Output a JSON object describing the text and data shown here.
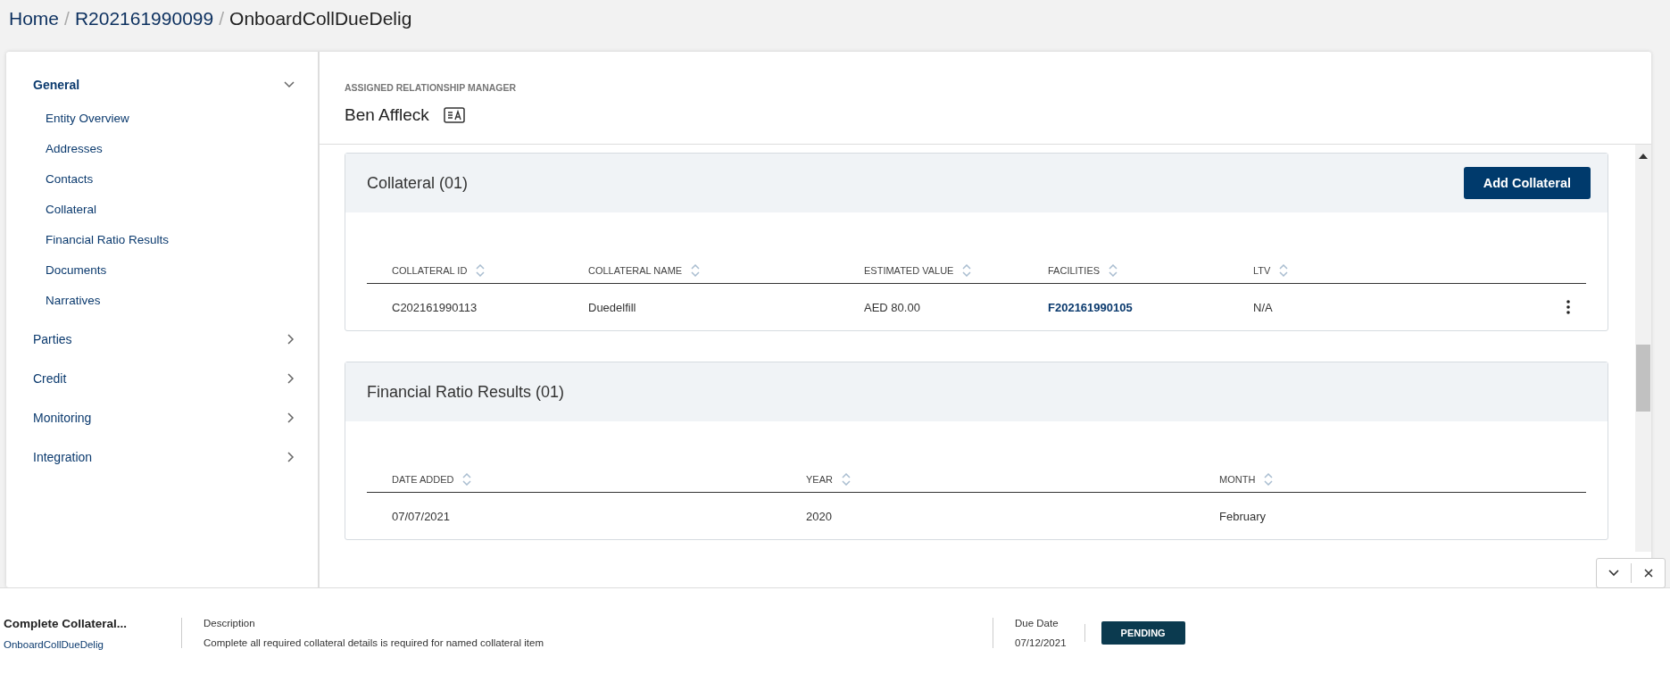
{
  "breadcrumb": {
    "separator": "/",
    "items": [
      {
        "label": "Home",
        "current": false
      },
      {
        "label": "R202161990099",
        "current": false
      },
      {
        "label": "OnboardCollDueDelig",
        "current": true
      }
    ]
  },
  "sidebar": {
    "sections": [
      {
        "label": "General",
        "expanded": true,
        "children": [
          {
            "label": "Entity Overview"
          },
          {
            "label": "Addresses"
          },
          {
            "label": "Contacts"
          },
          {
            "label": "Collateral"
          },
          {
            "label": "Financial Ratio Results"
          },
          {
            "label": "Documents"
          },
          {
            "label": "Narratives"
          }
        ]
      },
      {
        "label": "Parties",
        "expanded": false
      },
      {
        "label": "Credit",
        "expanded": false
      },
      {
        "label": "Monitoring",
        "expanded": false
      },
      {
        "label": "Integration",
        "expanded": false
      }
    ]
  },
  "header": {
    "label": "ASSIGNED RELATIONSHIP MANAGER",
    "name": "Ben Affleck"
  },
  "collateral": {
    "title": "Collateral (01)",
    "button": "Add Collateral",
    "columns": [
      {
        "label": "COLLATERAL ID",
        "kind": "text"
      },
      {
        "label": "COLLATERAL NAME",
        "kind": "text"
      },
      {
        "label": "ESTIMATED VALUE",
        "kind": "text"
      },
      {
        "label": "FACILITIES",
        "kind": "link"
      },
      {
        "label": "LTV",
        "kind": "text"
      }
    ],
    "rows": [
      {
        "cells": [
          "C202161990113",
          "Duedelfill",
          "AED 80.00",
          "F202161990105",
          "N/A"
        ]
      }
    ]
  },
  "financial_ratio_results": {
    "title": "Financial Ratio Results (01)",
    "columns": [
      {
        "label": "DATE ADDED"
      },
      {
        "label": "YEAR"
      },
      {
        "label": "MONTH"
      }
    ],
    "rows": [
      {
        "cells": [
          "07/07/2021",
          "2020",
          "February"
        ]
      }
    ]
  },
  "task_bar": {
    "title": "Complete Collateral...",
    "link": "OnboardCollDueDelig",
    "description_label": "Description",
    "description": "Complete all required collateral details is required for named collateral item",
    "due_label": "Due Date",
    "due_date": "07/12/2021",
    "status": "PENDING"
  }
}
